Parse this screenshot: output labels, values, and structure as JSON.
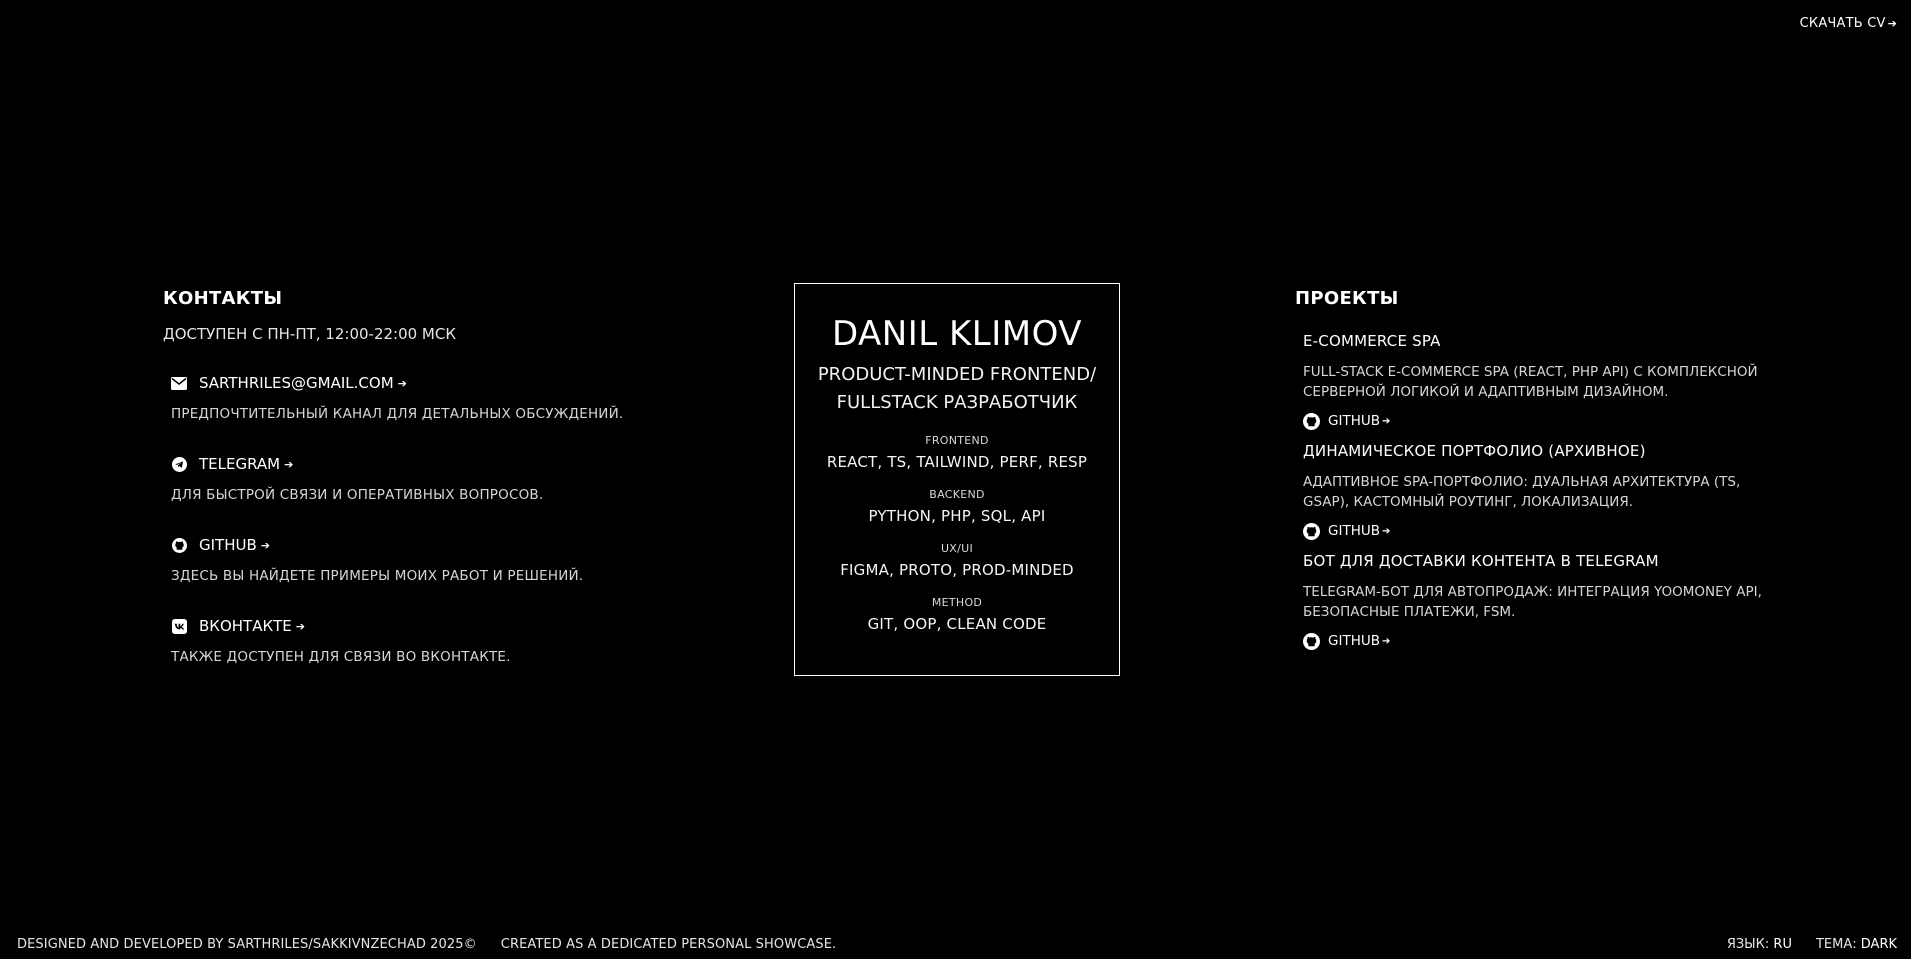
{
  "header": {
    "cv_label": "СКАЧАТЬ CV",
    "arrow": "➔"
  },
  "contacts": {
    "title": "КОНТАКТЫ",
    "availability": "ДОСТУПЕН С ПН-ПТ, 12:00-22:00 МСК",
    "items": [
      {
        "icon": "mail-icon",
        "label": "SARTHRILES@GMAIL.COM",
        "desc": "ПРЕДПОЧТИТЕЛЬНЫЙ КАНАЛ ДЛЯ ДЕТАЛЬНЫХ ОБСУЖДЕНИЙ."
      },
      {
        "icon": "telegram-icon",
        "label": "TELEGRAM",
        "desc": "ДЛЯ БЫСТРОЙ СВЯЗИ И ОПЕРАТИВНЫХ ВОПРОСОВ."
      },
      {
        "icon": "github-icon",
        "label": "GITHUB",
        "desc": "ЗДЕСЬ ВЫ НАЙДЕТЕ ПРИМЕРЫ МОИХ РАБОТ И РЕШЕНИЙ."
      },
      {
        "icon": "vk-icon",
        "label": "ВКОНТАКТЕ",
        "desc": "ТАКЖЕ ДОСТУПЕН ДЛЯ СВЯЗИ ВО ВКОНТАКТЕ."
      }
    ]
  },
  "card": {
    "name": "DANIL KLIMOV",
    "role_line1": "PRODUCT-MINDED FRONTEND/",
    "role_line2": "FULLSTACK РАЗРАБОТЧИК",
    "skills": [
      {
        "label": "FRONTEND",
        "value": "REACT, TS, TAILWIND, PERF, RESP"
      },
      {
        "label": "BACKEND",
        "value": "PYTHON, PHP, SQL, API"
      },
      {
        "label": "UX/UI",
        "value": "FIGMA, PROTO, PROD-MINDED"
      },
      {
        "label": "METHOD",
        "value": "GIT, OOP, CLEAN CODE"
      }
    ]
  },
  "projects": {
    "title": "ПРОЕКТЫ",
    "link_label": "GITHUB",
    "items": [
      {
        "title": "E-COMMERCE SPA",
        "desc": "FULL-STACK E-COMMERCE SPA (REACT, PHP API) С КОМПЛЕКСНОЙ СЕРВЕРНОЙ ЛОГИКОЙ И АДАПТИВНЫМ ДИЗАЙНОМ."
      },
      {
        "title": "ДИНАМИЧЕСКОЕ ПОРТФОЛИО (АРХИВНОЕ)",
        "desc": "АДАПТИВНОЕ SPA-ПОРТФОЛИО: ДУАЛЬНАЯ АРХИТЕКТУРА (TS, GSAP), КАСТОМНЫЙ РОУТИНГ, ЛОКАЛИЗАЦИЯ."
      },
      {
        "title": "БОТ ДЛЯ ДОСТАВКИ КОНТЕНТА В TELEGRAM",
        "desc": "TELEGRAM-БОТ ДЛЯ АВТОПРОДАЖ: ИНТЕГРАЦИЯ YOOMONEY API, БЕЗОПАСНЫЕ ПЛАТЕЖИ, FSM."
      }
    ]
  },
  "footer": {
    "credits": "DESIGNED AND DEVELOPED BY SARTHRILES/SAKKIVNZECHAD 2025©",
    "showcase": "CREATED AS A DEDICATED PERSONAL SHOWCASE.",
    "lang_label": "ЯЗЫК:",
    "lang_value": "RU",
    "theme_label": "ТЕМА:",
    "theme_value": "DARK"
  }
}
